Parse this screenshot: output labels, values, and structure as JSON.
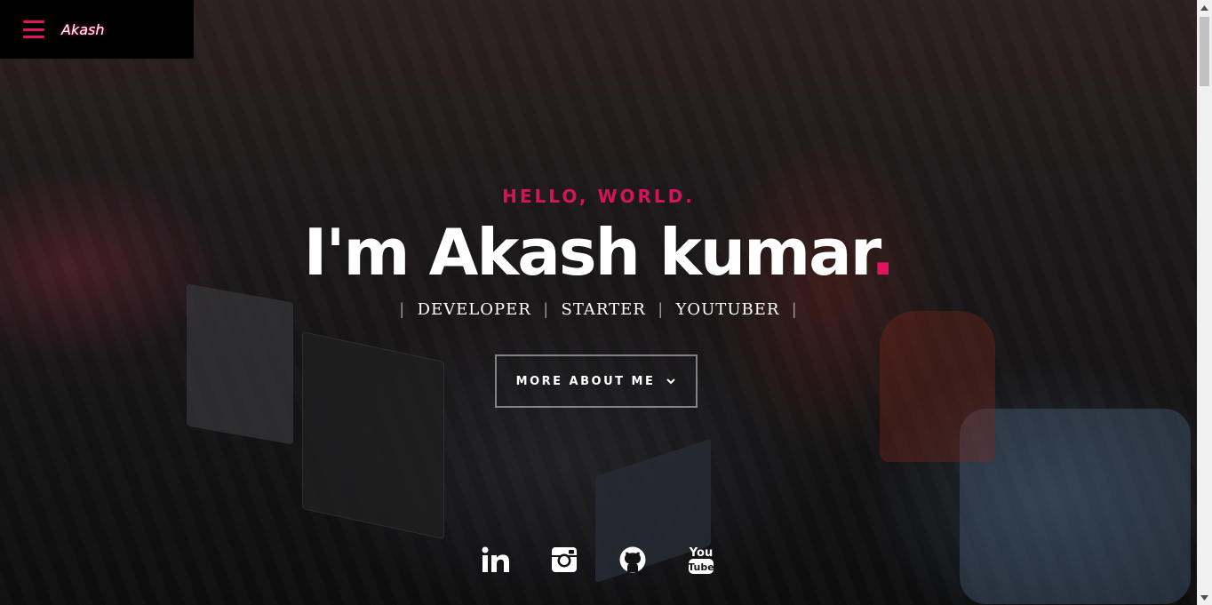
{
  "nav": {
    "brand": "Akash"
  },
  "hero": {
    "greeting": "HELLO, WORLD.",
    "headline": "I'm Akash kumar",
    "headline_dot": ".",
    "roles": [
      "DEVELOPER",
      "STARTER",
      "YOUTUBER"
    ],
    "separator": "|",
    "more_button": "MORE ABOUT ME"
  },
  "socials": [
    {
      "icon": "linkedin-icon"
    },
    {
      "icon": "instagram-icon"
    },
    {
      "icon": "github-icon"
    },
    {
      "icon": "youtube-icon",
      "text_top": "You",
      "text_bottom": "Tube"
    }
  ],
  "colors": {
    "accent": "#e0145e",
    "background": "#141314",
    "text": "#ffffff"
  }
}
